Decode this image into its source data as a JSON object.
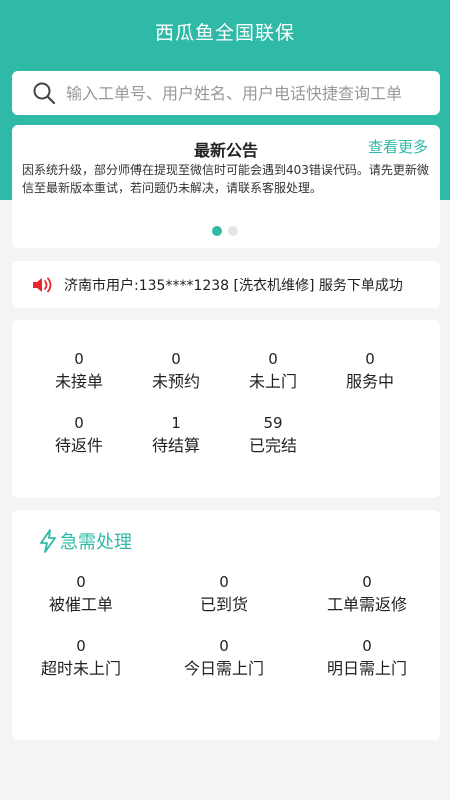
{
  "header": {
    "title": "西瓜鱼全国联保",
    "color": "#2ebaa6"
  },
  "search": {
    "placeholder": "输入工单号、用户姓名、用户电话快捷查询工单",
    "value": "",
    "icon": "search-icon"
  },
  "notice": {
    "title": "最新公告",
    "more_label": "查看更多",
    "body": "因系统升级，部分师傅在提现至微信时可能会遇到403错误代码。请先更新微信至最新版本重试，若问题仍未解决，请联系客服处理。",
    "active_page": 1,
    "page_count": 2
  },
  "ticker": {
    "icon": "speaker-icon",
    "text": "济南市用户:135****1238 [洗衣机维修] 服务下单成功"
  },
  "stats": {
    "items": [
      {
        "value": "0",
        "label": "未接单"
      },
      {
        "value": "0",
        "label": "未预约"
      },
      {
        "value": "0",
        "label": "未上门"
      },
      {
        "value": "0",
        "label": "服务中"
      },
      {
        "value": "0",
        "label": "待返件"
      },
      {
        "value": "1",
        "label": "待结算"
      },
      {
        "value": "59",
        "label": "已完结"
      }
    ]
  },
  "urgent": {
    "title": "急需处理",
    "icon": "lightning-icon",
    "items": [
      {
        "value": "0",
        "label": "被催工单"
      },
      {
        "value": "0",
        "label": "已到货"
      },
      {
        "value": "0",
        "label": "工单需返修"
      },
      {
        "value": "0",
        "label": "超时未上门"
      },
      {
        "value": "0",
        "label": "今日需上门"
      },
      {
        "value": "0",
        "label": "明日需上门"
      }
    ]
  }
}
